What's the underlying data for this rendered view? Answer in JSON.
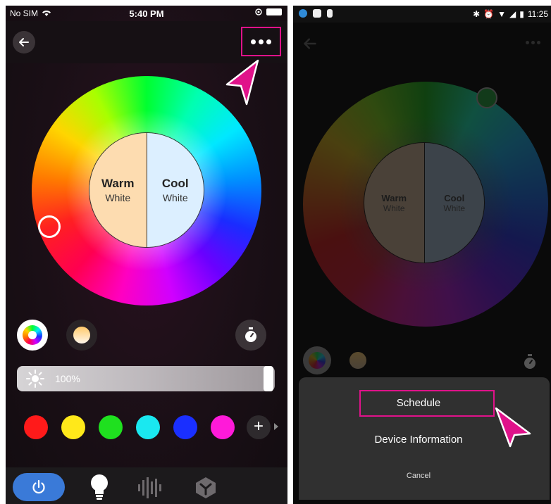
{
  "left_screen": {
    "status": {
      "carrier": "No SIM",
      "time": "5:40 PM"
    },
    "header": {
      "back_icon": "arrow-left-icon",
      "more_icon": "more-dots-icon"
    },
    "color_wheel": {
      "warm": {
        "title": "Warm",
        "subtitle": "White"
      },
      "cool": {
        "title": "Cool",
        "subtitle": "White"
      }
    },
    "brightness": {
      "label": "100%",
      "value": 1.0
    },
    "swatches": [
      "#ff1a1a",
      "#ffe81a",
      "#1fe01f",
      "#1ae8f0",
      "#1a2fff",
      "#ff1ad9"
    ],
    "colors": {
      "highlight": "#e0128a",
      "power_tab": "#3a7ad8"
    }
  },
  "right_screen": {
    "color_wheel": {
      "warm": {
        "title": "Warm",
        "subtitle": "White"
      },
      "cool": {
        "title": "Cool",
        "subtitle": "White"
      }
    },
    "status": {
      "time": "11:25"
    },
    "menu": {
      "schedule": "Schedule",
      "device_information": "Device Information",
      "cancel": "Cancel"
    }
  }
}
